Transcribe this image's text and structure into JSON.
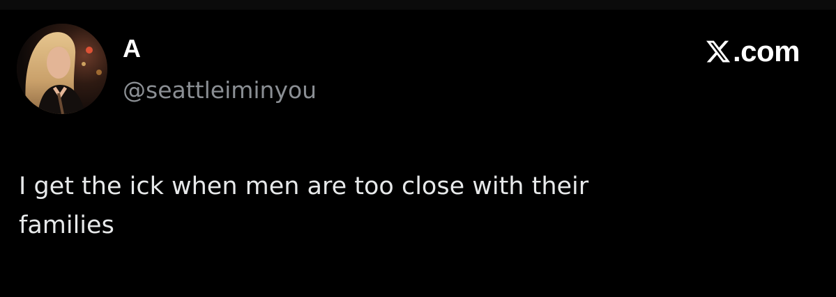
{
  "author": {
    "display_name": "A",
    "handle": "@seattleiminyou"
  },
  "brand": {
    "icon": "x-logo-icon",
    "suffix": ".com"
  },
  "tweet": {
    "text": "I get the ick when men are too close with their\nfamilies"
  },
  "colors": {
    "background": "#000000",
    "display_name": "#ffffff",
    "handle": "#8b8f94",
    "body_text": "#e7e9ea"
  }
}
